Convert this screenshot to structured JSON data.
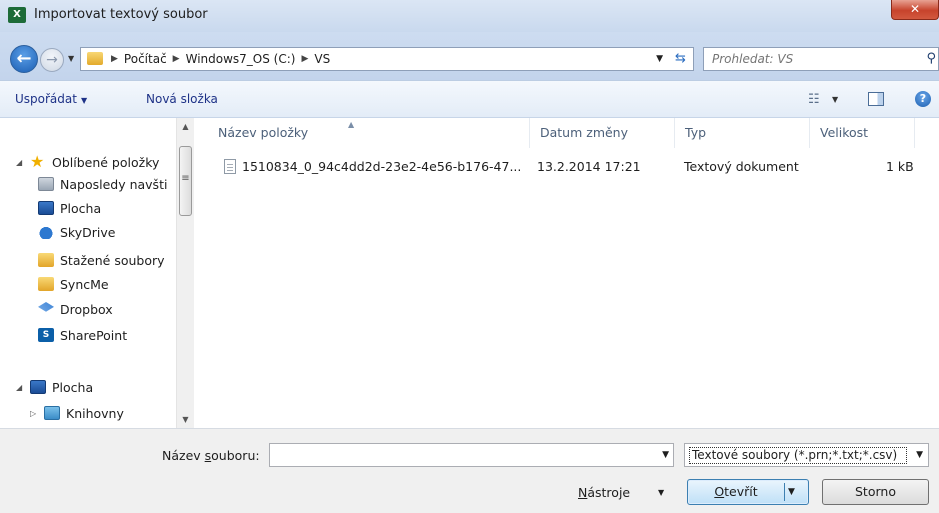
{
  "window": {
    "title": "Importovat textový soubor",
    "app_icon_text": "X",
    "close_label": "✕"
  },
  "nav": {
    "breadcrumbs": [
      "Počítač",
      "Windows7_OS (C:)",
      "VS"
    ],
    "search_placeholder": "Prohledat: VS"
  },
  "toolbar": {
    "organize_label": "Uspořádat",
    "new_folder_label": "Nová složka"
  },
  "sidebar": {
    "favorites_label": "Oblíbené položky",
    "items": [
      "Naposledy navšti",
      "Plocha",
      "SkyDrive",
      "Stažené soubory",
      "SyncMe",
      "Dropbox",
      "SharePoint"
    ],
    "desktop_label": "Plocha",
    "libraries_label": "Knihovny"
  },
  "files": {
    "columns": [
      "Název položky",
      "Datum změny",
      "Typ",
      "Velikost"
    ],
    "rows": [
      {
        "name": "1510834_0_94c4dd2d-23e2-4e56-b176-47...",
        "date": "13.2.2014 17:21",
        "type": "Textový dokument",
        "size": "1 kB"
      }
    ]
  },
  "bottom": {
    "filename_label_pre": "Název ",
    "filename_label_access": "s",
    "filename_label_post": "ouboru:",
    "filename_value": "",
    "filter_value": "Textové soubory (*.prn;*.txt;*.csv)",
    "tools_label_access": "N",
    "tools_label_post": "ástroje",
    "open_label_access": "O",
    "open_label_post": "tevřít",
    "cancel_label": "Storno"
  },
  "colors": {
    "accent": "#1e3287",
    "title_bar": "#c9d9ee",
    "close": "#c7432c"
  }
}
